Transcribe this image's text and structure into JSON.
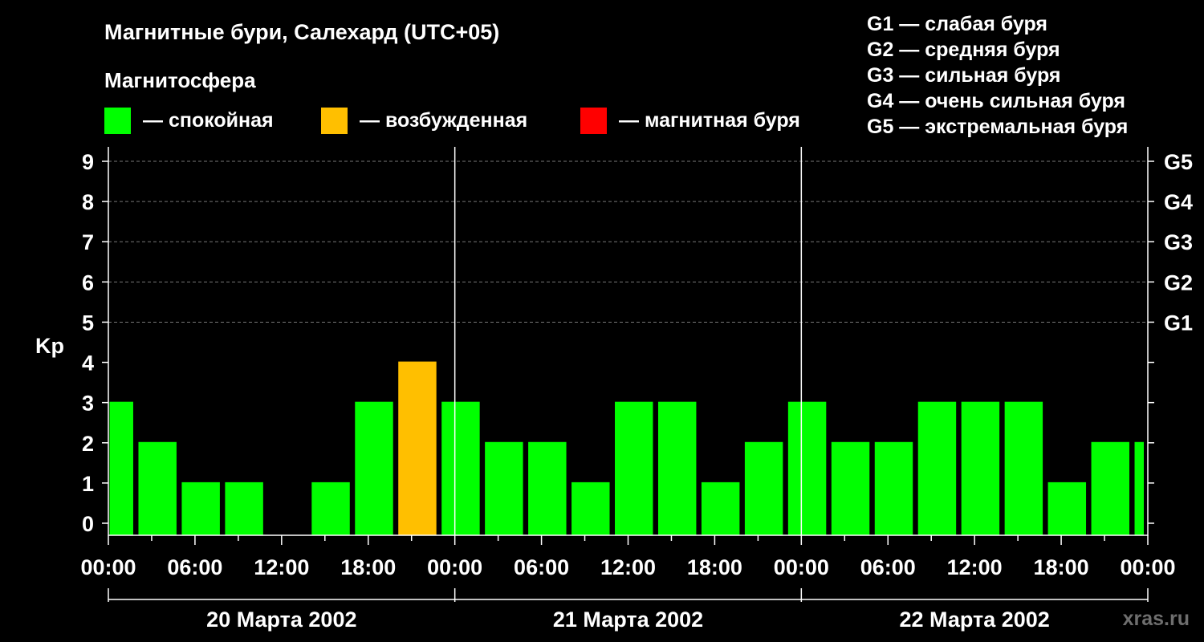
{
  "chart_data": {
    "type": "bar",
    "title": "Магнитные бури, Салехард (UTC+05)",
    "subtitle": "Магнитосфера",
    "ylabel": "Kp",
    "ylim": [
      0,
      9
    ],
    "yticks": [
      "0",
      "1",
      "2",
      "3",
      "4",
      "5",
      "6",
      "7",
      "8",
      "9"
    ],
    "right_ticks": [
      {
        "value": 5,
        "label": "G1"
      },
      {
        "value": 6,
        "label": "G2"
      },
      {
        "value": 7,
        "label": "G3"
      },
      {
        "value": 8,
        "label": "G4"
      },
      {
        "value": 9,
        "label": "G5"
      }
    ],
    "x_hours_range": [
      0,
      72
    ],
    "xticks": [
      {
        "hour": 0,
        "label": "00:00"
      },
      {
        "hour": 6,
        "label": "06:00"
      },
      {
        "hour": 12,
        "label": "12:00"
      },
      {
        "hour": 18,
        "label": "18:00"
      },
      {
        "hour": 24,
        "label": "00:00"
      },
      {
        "hour": 30,
        "label": "06:00"
      },
      {
        "hour": 36,
        "label": "12:00"
      },
      {
        "hour": 42,
        "label": "18:00"
      },
      {
        "hour": 48,
        "label": "00:00"
      },
      {
        "hour": 54,
        "label": "06:00"
      },
      {
        "hour": 60,
        "label": "12:00"
      },
      {
        "hour": 66,
        "label": "18:00"
      },
      {
        "hour": 72,
        "label": "00:00"
      }
    ],
    "days": [
      {
        "label": "20 Марта 2002",
        "start": 0,
        "end": 24
      },
      {
        "label": "21 Марта 2002",
        "start": 24,
        "end": 48
      },
      {
        "label": "22 Марта 2002",
        "start": 48,
        "end": 72
      }
    ],
    "day_separators": [
      24,
      48
    ],
    "bars": [
      {
        "start": 0,
        "end": 2,
        "value": 3,
        "level": "quiet"
      },
      {
        "start": 2,
        "end": 5,
        "value": 2,
        "level": "quiet"
      },
      {
        "start": 5,
        "end": 8,
        "value": 1,
        "level": "quiet"
      },
      {
        "start": 8,
        "end": 11,
        "value": 1,
        "level": "quiet"
      },
      {
        "start": 11,
        "end": 14,
        "value": 0,
        "level": "quiet"
      },
      {
        "start": 14,
        "end": 17,
        "value": 1,
        "level": "quiet"
      },
      {
        "start": 17,
        "end": 20,
        "value": 3,
        "level": "quiet"
      },
      {
        "start": 20,
        "end": 23,
        "value": 4,
        "level": "excited"
      },
      {
        "start": 23,
        "end": 26,
        "value": 3,
        "level": "quiet"
      },
      {
        "start": 26,
        "end": 29,
        "value": 2,
        "level": "quiet"
      },
      {
        "start": 29,
        "end": 32,
        "value": 2,
        "level": "quiet"
      },
      {
        "start": 32,
        "end": 35,
        "value": 1,
        "level": "quiet"
      },
      {
        "start": 35,
        "end": 38,
        "value": 3,
        "level": "quiet"
      },
      {
        "start": 38,
        "end": 41,
        "value": 3,
        "level": "quiet"
      },
      {
        "start": 41,
        "end": 44,
        "value": 1,
        "level": "quiet"
      },
      {
        "start": 44,
        "end": 47,
        "value": 2,
        "level": "quiet"
      },
      {
        "start": 47,
        "end": 50,
        "value": 3,
        "level": "quiet"
      },
      {
        "start": 50,
        "end": 53,
        "value": 2,
        "level": "quiet"
      },
      {
        "start": 53,
        "end": 56,
        "value": 2,
        "level": "quiet"
      },
      {
        "start": 56,
        "end": 59,
        "value": 3,
        "level": "quiet"
      },
      {
        "start": 59,
        "end": 62,
        "value": 3,
        "level": "quiet"
      },
      {
        "start": 62,
        "end": 65,
        "value": 3,
        "level": "quiet"
      },
      {
        "start": 65,
        "end": 68,
        "value": 1,
        "level": "quiet"
      },
      {
        "start": 68,
        "end": 71,
        "value": 2,
        "level": "quiet"
      },
      {
        "start": 71,
        "end": 72,
        "value": 2,
        "level": "quiet"
      }
    ],
    "legend": [
      {
        "key": "quiet",
        "label": "— спокойная",
        "color": "#00ff00"
      },
      {
        "key": "excited",
        "label": "— возбужденная",
        "color": "#ffbf00"
      },
      {
        "key": "storm",
        "label": "— магнитная буря",
        "color": "#ff0000"
      }
    ],
    "storm_scale": [
      "G1 — слабая буря",
      "G2 — средняя буря",
      "G3 — сильная буря",
      "G4 — очень сильная буря",
      "G5 — экстремальная буря"
    ],
    "grid": true
  },
  "watermark": "xras.ru"
}
